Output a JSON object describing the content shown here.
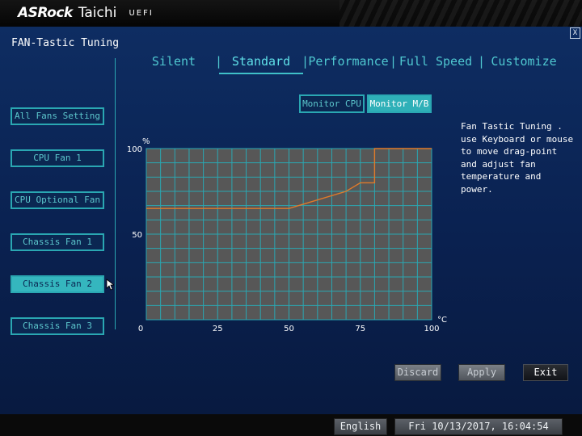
{
  "header": {
    "brand": "ASRock",
    "series": "Taichi",
    "firmware": "UEFI"
  },
  "page": {
    "title": "FAN-Tastic Tuning",
    "close_label": "X"
  },
  "tabs": [
    {
      "label": "Silent",
      "active": false
    },
    {
      "label": "Standard",
      "active": true
    },
    {
      "label": "Performance",
      "active": false
    },
    {
      "label": "Full Speed",
      "active": false
    },
    {
      "label": "Customize",
      "active": false
    }
  ],
  "tab_separator": "|",
  "sidebar": {
    "items": [
      {
        "label": "All Fans Setting",
        "active": false
      },
      {
        "label": "CPU Fan 1",
        "active": false
      },
      {
        "label": "CPU Optional Fan",
        "active": false
      },
      {
        "label": "Chassis Fan 1",
        "active": false
      },
      {
        "label": "Chassis Fan 2",
        "active": true
      },
      {
        "label": "Chassis Fan 3",
        "active": false
      }
    ]
  },
  "monitor": {
    "cpu_label": "Monitor CPU",
    "mb_label": "Monitor M/B",
    "selected": "Monitor M/B"
  },
  "chart_data": {
    "type": "line",
    "x_unit": "°C",
    "y_unit": "%",
    "xlim": [
      0,
      100
    ],
    "ylim": [
      0,
      100
    ],
    "x_ticks": [
      0,
      25,
      50,
      75,
      100
    ],
    "y_ticks": [
      50,
      100
    ],
    "x_tick_labels": [
      "25",
      "50",
      "75",
      "100"
    ],
    "origin_label": "0",
    "y_tick_labels": [
      "50",
      "100"
    ],
    "grid": true,
    "series": [
      {
        "x": [
          0,
          50,
          70,
          75,
          80,
          80,
          100
        ],
        "y": [
          65,
          65,
          75,
          80,
          80,
          100,
          100
        ],
        "color": "#e07a2a"
      }
    ]
  },
  "help_text": "Fan Tastic Tuning . use Keyboard or mouse to move drag-point and adjust fan temperature and power.",
  "footer": {
    "discard": "Discard",
    "apply": "Apply",
    "exit": "Exit"
  },
  "statusbar": {
    "language": "English",
    "datetime": "Fri 10/13/2017, 16:04:54"
  },
  "colors": {
    "accent": "#2aa7b2",
    "curve": "#e07a2a",
    "panel": "#0b2752"
  }
}
